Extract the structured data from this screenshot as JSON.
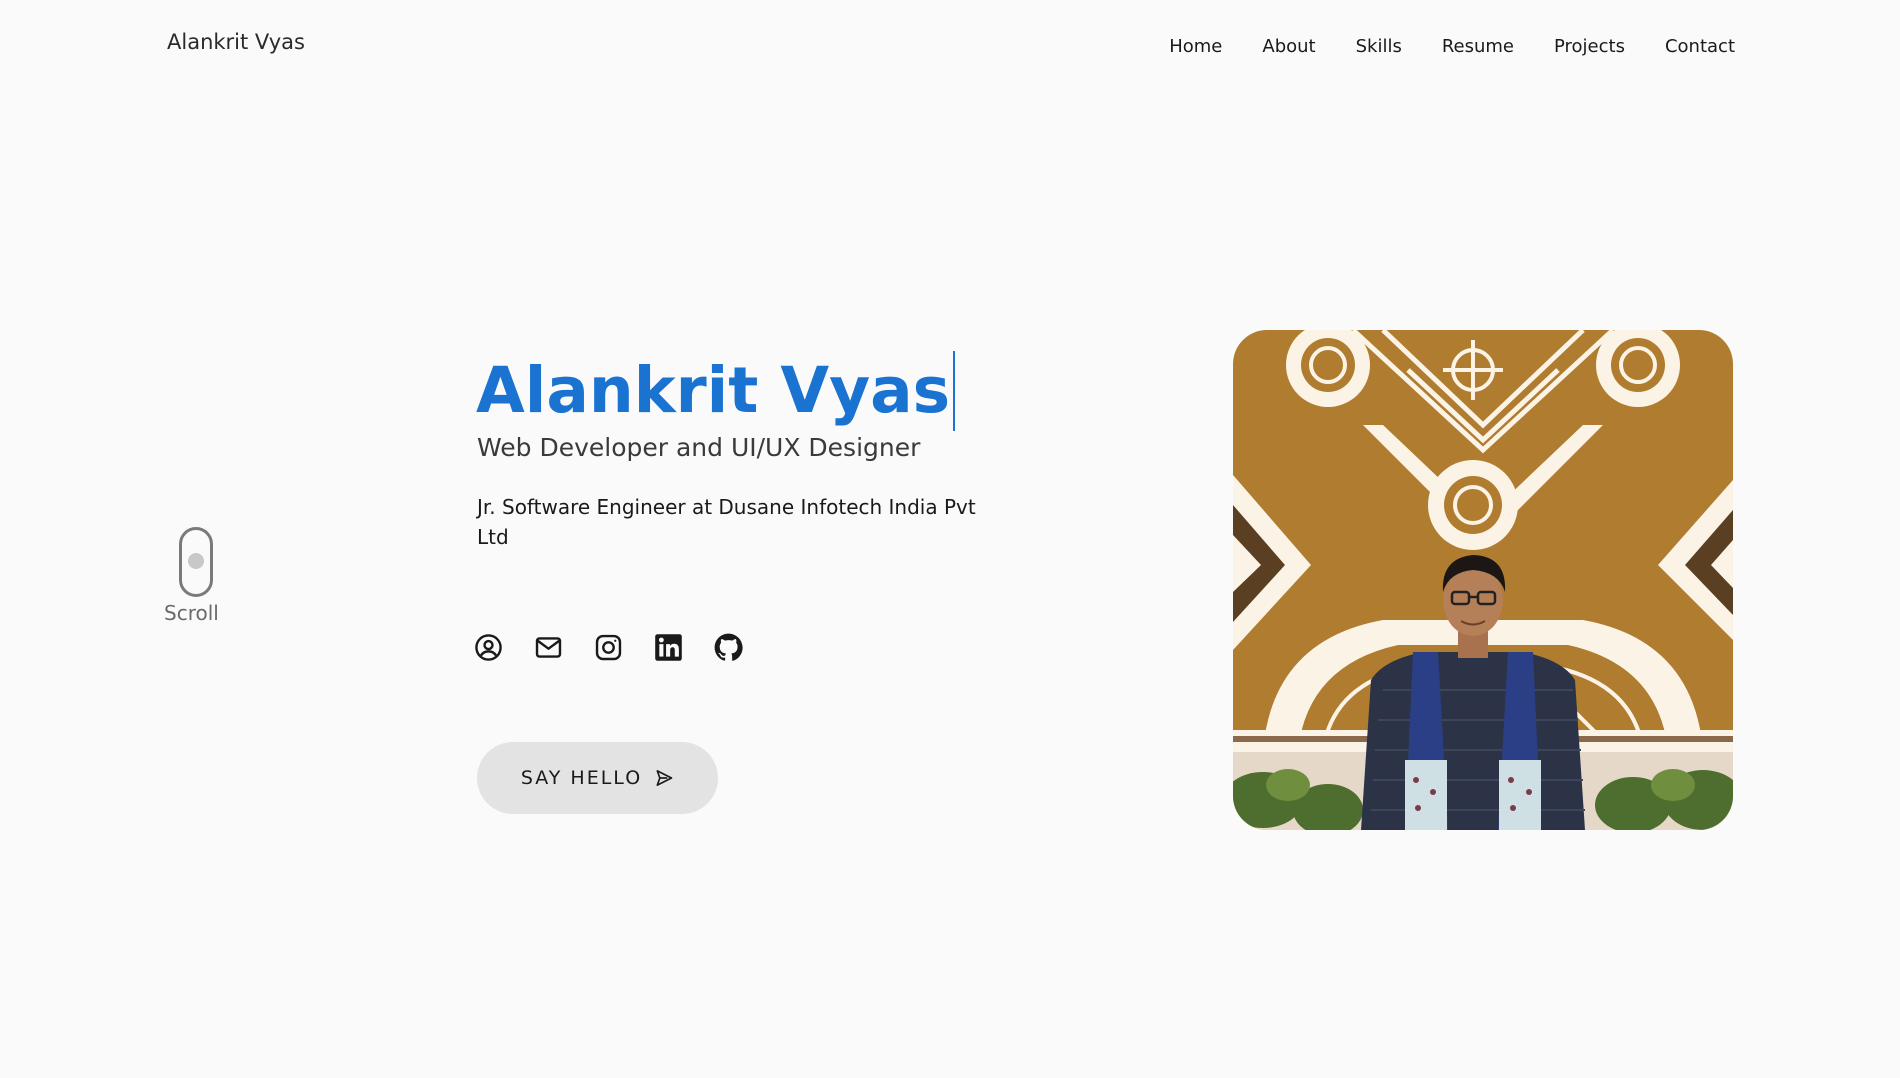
{
  "header": {
    "logo": "Alankrit Vyas",
    "nav": [
      "Home",
      "About",
      "Skills",
      "Resume",
      "Projects",
      "Contact"
    ]
  },
  "hero": {
    "name": "Alankrit Vyas",
    "title": "Web Developer and UI/UX Designer",
    "job": "Jr. Software Engineer at Dusane Infotech India Pvt Ltd",
    "button_label": "SAY HELLO",
    "socials": [
      "user-circle-icon",
      "mail-icon",
      "instagram-icon",
      "linkedin-icon",
      "github-icon"
    ]
  },
  "scroll": {
    "label": "Scroll"
  },
  "colors": {
    "accent": "#1a73d0",
    "background": "#fafafa",
    "button_bg": "#e3e3e3",
    "photo_wall": "#b07c30"
  }
}
